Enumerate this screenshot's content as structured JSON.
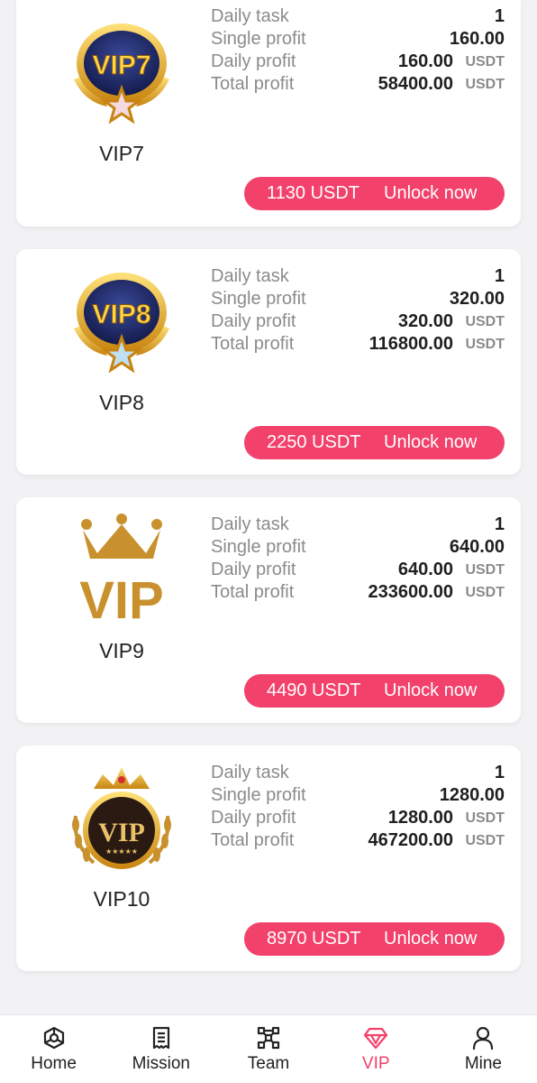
{
  "cards": [
    {
      "level": "VIP7",
      "badge_text": "VIP7",
      "stats": [
        {
          "label": "Daily task",
          "value": "1",
          "unit": ""
        },
        {
          "label": "Single profit",
          "value": "160.00",
          "unit": ""
        },
        {
          "label": "Daily profit",
          "value": "160.00",
          "unit": "USDT"
        },
        {
          "label": "Total profit",
          "value": "58400.00",
          "unit": "USDT"
        }
      ],
      "price": "1130 USDT",
      "action": "Unlock now"
    },
    {
      "level": "VIP8",
      "badge_text": "VIP8",
      "stats": [
        {
          "label": "Daily task",
          "value": "1",
          "unit": ""
        },
        {
          "label": "Single profit",
          "value": "320.00",
          "unit": ""
        },
        {
          "label": "Daily profit",
          "value": "320.00",
          "unit": "USDT"
        },
        {
          "label": "Total profit",
          "value": "116800.00",
          "unit": "USDT"
        }
      ],
      "price": "2250 USDT",
      "action": "Unlock now"
    },
    {
      "level": "VIP9",
      "badge_text": "VIP",
      "stats": [
        {
          "label": "Daily task",
          "value": "1",
          "unit": ""
        },
        {
          "label": "Single profit",
          "value": "640.00",
          "unit": ""
        },
        {
          "label": "Daily profit",
          "value": "640.00",
          "unit": "USDT"
        },
        {
          "label": "Total profit",
          "value": "233600.00",
          "unit": "USDT"
        }
      ],
      "price": "4490 USDT",
      "action": "Unlock now"
    },
    {
      "level": "VIP10",
      "badge_text": "VIP",
      "stats": [
        {
          "label": "Daily task",
          "value": "1",
          "unit": ""
        },
        {
          "label": "Single profit",
          "value": "1280.00",
          "unit": ""
        },
        {
          "label": "Daily profit",
          "value": "1280.00",
          "unit": "USDT"
        },
        {
          "label": "Total profit",
          "value": "467200.00",
          "unit": "USDT"
        }
      ],
      "price": "8970 USDT",
      "action": "Unlock now"
    }
  ],
  "tabbar": {
    "home": "Home",
    "mission": "Mission",
    "team": "Team",
    "vip": "VIP",
    "mine": "Mine",
    "active": "vip"
  },
  "colors": {
    "accent": "#f2416b",
    "gold": "#c8912e",
    "navy": "#1b2460"
  }
}
